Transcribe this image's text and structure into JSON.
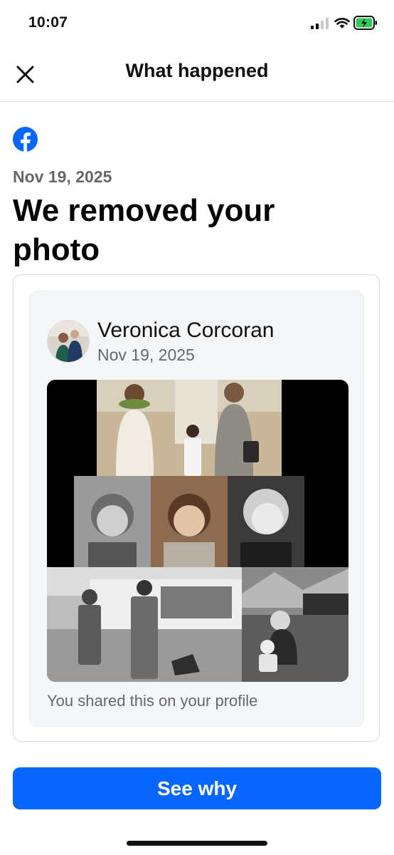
{
  "status": {
    "time": "10:07"
  },
  "header": {
    "title": "What happened",
    "close_icon": "close-icon"
  },
  "notice": {
    "platform_icon": "facebook-icon",
    "date": "Nov 19, 2025",
    "headline": "We removed your photo"
  },
  "post": {
    "author": "Veronica Corcoran",
    "date": "Nov 19, 2025",
    "caption": "You shared this on your profile"
  },
  "actions": {
    "see_why": "See why"
  },
  "colors": {
    "brand": "#0866ff",
    "muted_text": "#65676b",
    "card_bg": "#f5f6f8"
  }
}
